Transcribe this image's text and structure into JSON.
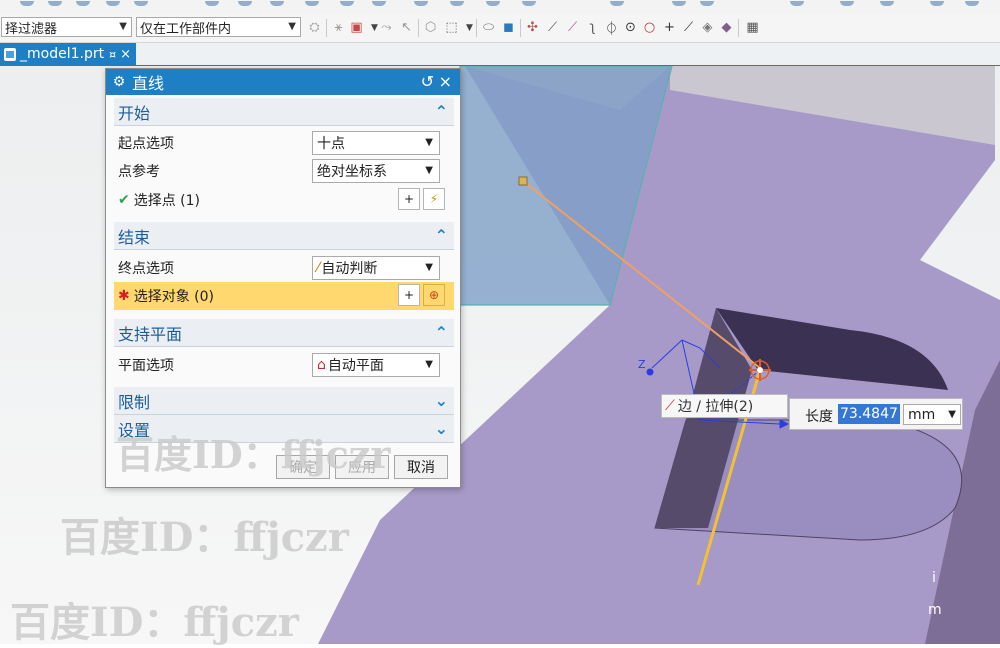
{
  "toolbar": {
    "filter_combo": "择过滤器",
    "scope_combo": "仅在工作部件内"
  },
  "file_tab": {
    "name": "_model1.prt",
    "pin": "¤",
    "close": "×"
  },
  "dialog": {
    "title": "直线",
    "reset_icon": "↺",
    "close_icon": "×",
    "start": {
      "heading": "开始",
      "start_option_label": "起点选项",
      "start_option_value": "十点",
      "point_ref_label": "点参考",
      "point_ref_value": "绝对坐标系",
      "select_point": "选择点 (1)"
    },
    "end": {
      "heading": "结束",
      "end_option_label": "终点选项",
      "end_option_value": "自动判断",
      "select_object": "选择对象 (0)"
    },
    "support_plane": {
      "heading": "支持平面",
      "plane_option_label": "平面选项",
      "plane_option_value": "自动平面"
    },
    "limits": {
      "heading": "限制"
    },
    "settings": {
      "heading": "设置"
    },
    "buttons": {
      "ok": "确定",
      "apply": "应用",
      "cancel": "取消"
    }
  },
  "snap_tooltip": "边 / 拉伸(2)",
  "length_entry": {
    "label": "长度",
    "value": "73.4847",
    "unit": "mm"
  },
  "watermarks": [
    "百度ID：ffjczr",
    "百度ID：ffjczr",
    "百度ID：ffjczr"
  ],
  "colors": {
    "accent": "#1f7fc4",
    "datum_plane": "#7fa0c8",
    "body_face": "#a79ac9",
    "dark_face": "#3b3152",
    "highlight_row": "#ffd970",
    "rubber_line": "#f0a060",
    "preview_line": "#f1c232"
  }
}
